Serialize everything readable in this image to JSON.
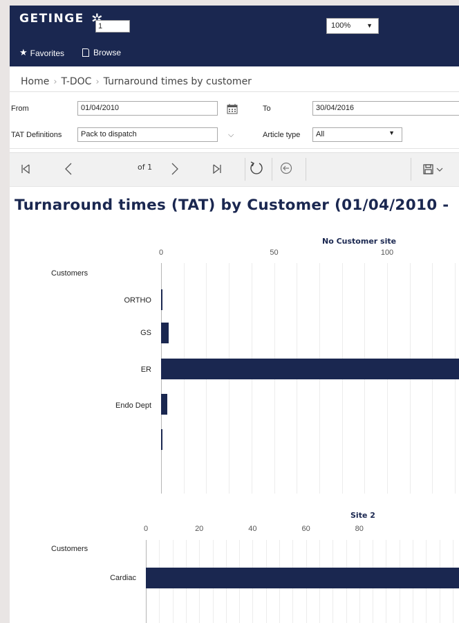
{
  "app": {
    "brand": "GETINGE",
    "brand_mark": "✲",
    "menu": [
      {
        "label": "Favorites",
        "icon": "star-icon"
      },
      {
        "label": "Browse",
        "icon": "document-icon"
      }
    ]
  },
  "breadcrumb": [
    "Home",
    "T-DOC",
    "Turnaround times by customer"
  ],
  "params": {
    "from_label": "From",
    "from_value": "01/04/2010",
    "to_label": "To",
    "to_value": "30/04/2016",
    "tat_label": "TAT Definitions",
    "tat_value": "Pack to dispatch",
    "article_label": "Article type",
    "article_value": "All"
  },
  "toolbar": {
    "page_value": "1",
    "page_of": "of 1",
    "zoom_value": "100%"
  },
  "report": {
    "title": "Turnaround times (TAT) by Customer (01/04/2010 -"
  },
  "colors": {
    "brand": "#1a2750",
    "bar": "#1a2750"
  },
  "chart_data": [
    {
      "type": "bar",
      "orientation": "horizontal",
      "title": "No Customer site",
      "ylabel": "Customers",
      "categories": [
        "ORTHO",
        "GS",
        "ER",
        "Endo Dept",
        ""
      ],
      "values": [
        0.3,
        3.5,
        140,
        2.7,
        0.3
      ],
      "xticks": [
        0,
        50,
        100
      ],
      "xlim": [
        0,
        130
      ],
      "grid": true
    },
    {
      "type": "bar",
      "orientation": "horizontal",
      "title": "Site 2",
      "ylabel": "Customers",
      "categories": [
        "Cardiac"
      ],
      "values": [
        120
      ],
      "xticks": [
        0,
        20,
        40,
        60,
        80
      ],
      "xlim": [
        0,
        100
      ],
      "grid": true
    }
  ]
}
